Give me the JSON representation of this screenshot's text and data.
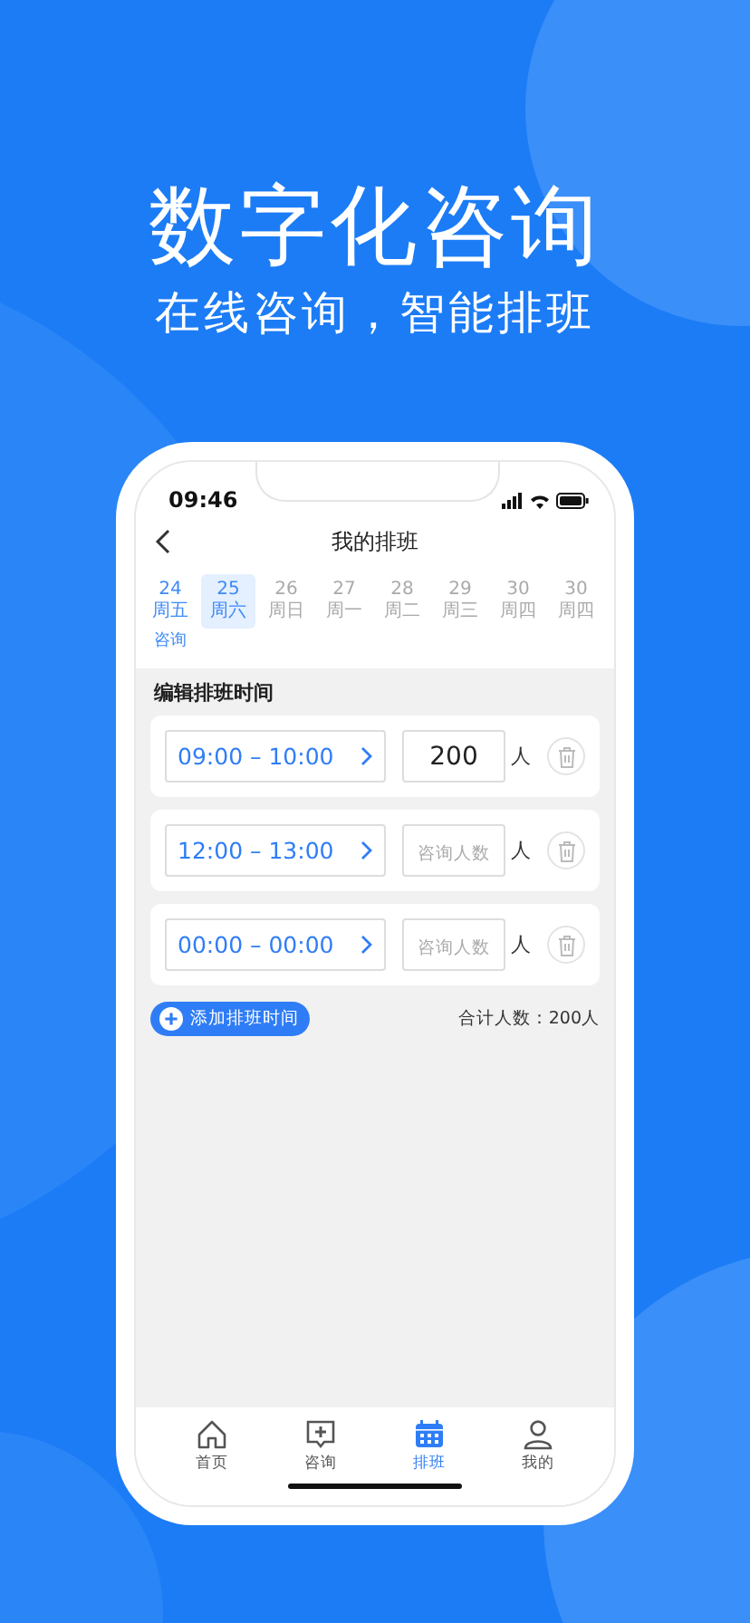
{
  "headline": "数字化咨询",
  "subtitle": "在线咨询，智能排班",
  "status_bar": {
    "time": "09:46"
  },
  "nav": {
    "title": "我的排班"
  },
  "dates": [
    {
      "day": "24",
      "weekday": "周五",
      "highlighted": true,
      "selected": false,
      "note": "咨询"
    },
    {
      "day": "25",
      "weekday": "周六",
      "highlighted": true,
      "selected": true
    },
    {
      "day": "26",
      "weekday": "周日",
      "highlighted": false,
      "selected": false
    },
    {
      "day": "27",
      "weekday": "周一",
      "highlighted": false,
      "selected": false
    },
    {
      "day": "28",
      "weekday": "周二",
      "highlighted": false,
      "selected": false
    },
    {
      "day": "29",
      "weekday": "周三",
      "highlighted": false,
      "selected": false
    },
    {
      "day": "30",
      "weekday": "周四",
      "highlighted": false,
      "selected": false
    },
    {
      "day": "30",
      "weekday": "周四",
      "highlighted": false,
      "selected": false
    }
  ],
  "section_title": "编辑排班时间",
  "slots": [
    {
      "time_range": "09:00 – 10:00",
      "count": "200",
      "unit": "人"
    },
    {
      "time_range": "12:00 – 13:00",
      "placeholder": "咨询人数",
      "unit": "人"
    },
    {
      "time_range": "00:00 – 00:00",
      "placeholder": "咨询人数",
      "unit": "人"
    }
  ],
  "add_button": "添加排班时间",
  "total": "合计人数：200人",
  "tabs": [
    {
      "label": "首页",
      "selected": false
    },
    {
      "label": "咨询",
      "selected": false
    },
    {
      "label": "排班",
      "selected": true
    },
    {
      "label": "我的",
      "selected": false
    }
  ]
}
